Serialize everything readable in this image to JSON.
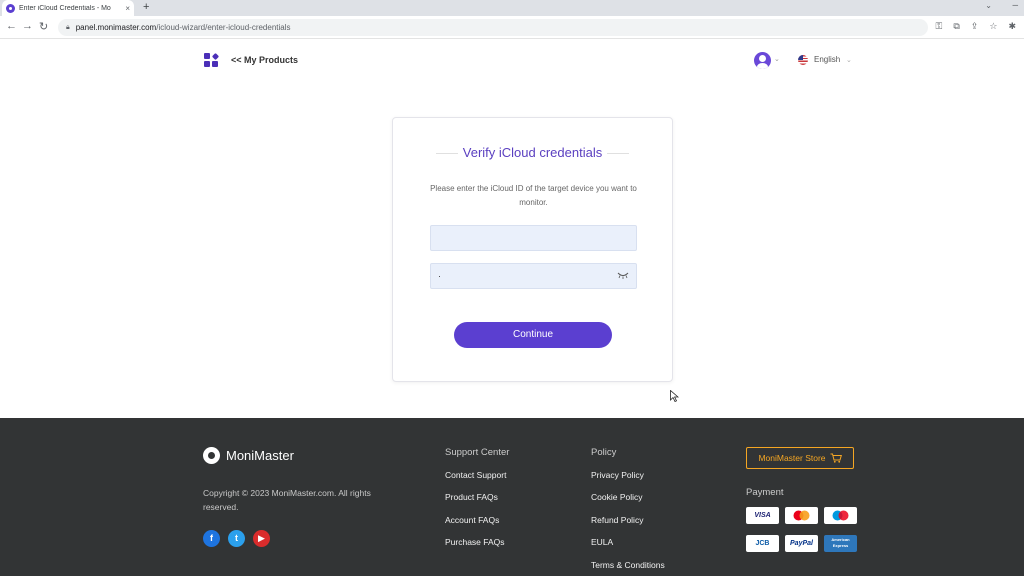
{
  "browser": {
    "tab_title": "Enter iCloud Credentials - Mo",
    "tab_close": "×",
    "new_tab": "+",
    "url_host": "panel.monimaster.com",
    "url_path": "/icloud-wizard/enter-icloud-credentials"
  },
  "header": {
    "back_link": "<< My Products",
    "language": "English"
  },
  "card": {
    "title": "Verify iCloud credentials",
    "description": "Please enter the iCloud ID of the target device you want to monitor.",
    "id_value": "",
    "password_value": "·",
    "continue_label": "Continue"
  },
  "footer": {
    "brand": "MoniMaster",
    "copyright": "Copyright © 2023 MoniMaster.com. All rights reserved.",
    "support": {
      "title": "Support Center",
      "links": [
        "Contact Support",
        "Product FAQs",
        "Account FAQs",
        "Purchase FAQs"
      ]
    },
    "policy": {
      "title": "Policy",
      "links": [
        "Privacy Policy",
        "Cookie Policy",
        "Refund Policy",
        "EULA",
        "Terms & Conditions"
      ]
    },
    "store_label": "MoniMaster Store",
    "payment_title": "Payment",
    "payment_methods": [
      "VISA",
      "Mastercard",
      "Maestro",
      "JCB",
      "PayPal",
      "American Express"
    ]
  },
  "colors": {
    "accent": "#5b3fd0",
    "footer_bg": "#323435",
    "store_orange": "#f5a623"
  },
  "icons": [
    "grid-icon",
    "avatar-icon",
    "us-flag-icon",
    "eye-closed-icon",
    "cart-icon",
    "facebook-icon",
    "twitter-icon",
    "youtube-icon"
  ]
}
